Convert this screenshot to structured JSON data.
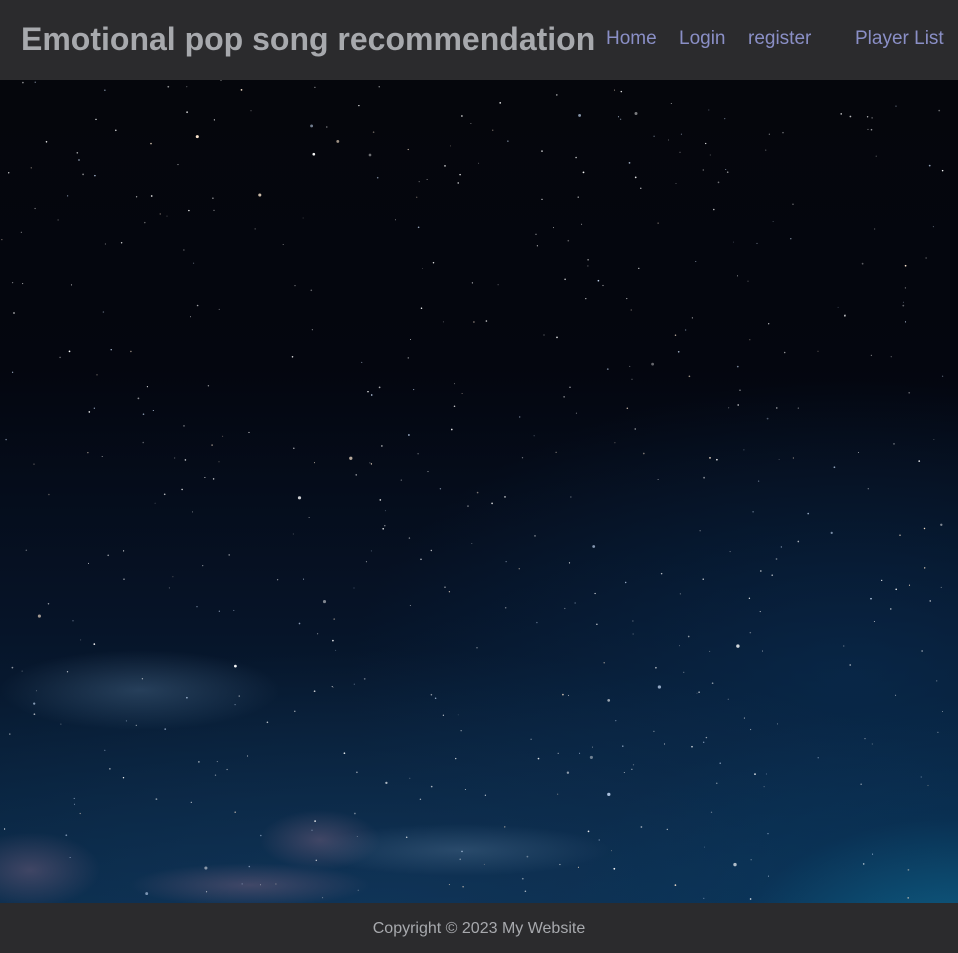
{
  "header": {
    "title": "Emotional pop song recommendation",
    "nav": [
      {
        "label": "Home"
      },
      {
        "label": "Login"
      },
      {
        "label": "register"
      },
      {
        "label": "Player List"
      }
    ]
  },
  "hero": {
    "image": "starry-night-sky"
  },
  "footer": {
    "copyright": "Copyright © 2023 My Website"
  },
  "colors": {
    "bar_bg": "#2b2b2d",
    "title_text": "#a7a9ad",
    "nav_link": "#8a8fc6"
  }
}
